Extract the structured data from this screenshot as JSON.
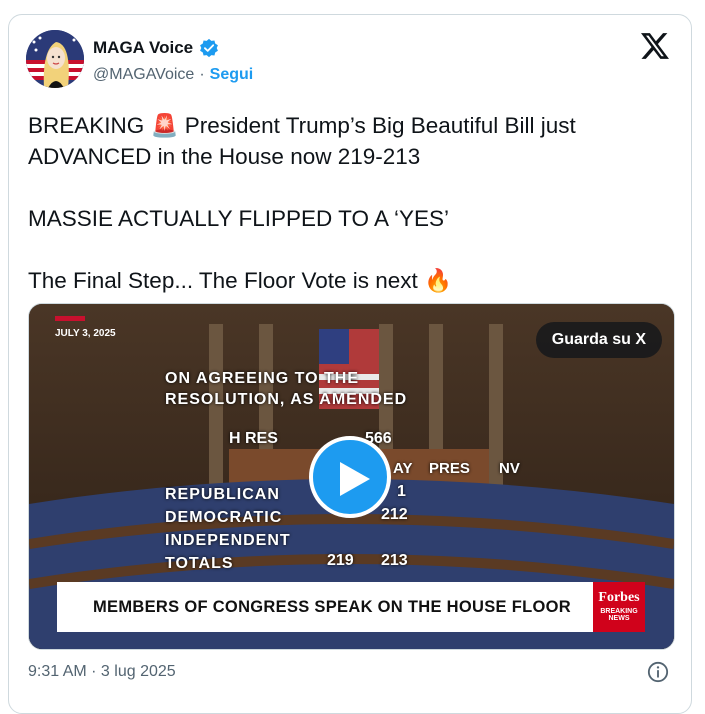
{
  "author": {
    "name": "MAGA Voice",
    "handle": "@MAGAVoice",
    "separator": "·",
    "follow_label": "Segui",
    "verified_icon": "verified-badge-icon"
  },
  "tweet": {
    "line1": "BREAKING 🚨 President Trump’s Big Beautiful Bill just ADVANCED in the House now 219-213",
    "line2": "MASSIE ACTUALLY FLIPPED TO A ‘YES’",
    "line3": "The Final Step... The Floor Vote is next 🔥"
  },
  "video": {
    "date": "JULY 3, 2025",
    "watch_label": "Guarda su X",
    "caption_top1": "ON AGREEING TO THE",
    "caption_top2": "RESOLUTION, AS AMENDED",
    "bill": "H RES",
    "bill_num": "566",
    "col_yay": "AY",
    "col_pres": "PRES",
    "col_nv": "NV",
    "row1": "REPUBLICAN",
    "row1_val": "1",
    "row2": "DEMOCRATIC",
    "row2_val": "212",
    "row3": "INDEPENDENT",
    "row4": "TOTALS",
    "total_yea": "219",
    "total_nay": "213",
    "lower_third": "MEMBERS OF CONGRESS SPEAK ON THE HOUSE FLOOR",
    "brand": "Forbes",
    "brand_sub1": "BREAKING",
    "brand_sub2": "NEWS"
  },
  "footer": {
    "timestamp": "9:31 AM · 3 lug 2025",
    "info_icon": "info-icon"
  },
  "colors": {
    "accent": "#1d9bf0",
    "text": "#0f1419",
    "muted": "#536471",
    "forbes_red": "#d0021b"
  }
}
